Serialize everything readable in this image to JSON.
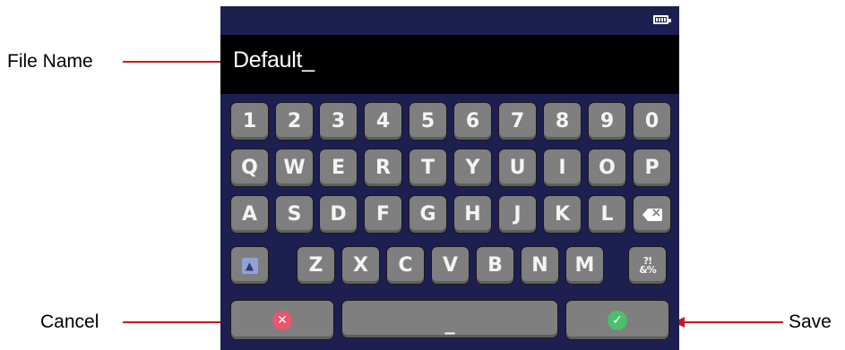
{
  "callouts": {
    "file_name": "File Name",
    "cancel": "Cancel",
    "save": "Save"
  },
  "filename_value": "Default_",
  "keyboard": {
    "row1": [
      "1",
      "2",
      "3",
      "4",
      "5",
      "6",
      "7",
      "8",
      "9",
      "0"
    ],
    "row2": [
      "Q",
      "W",
      "E",
      "R",
      "T",
      "Y",
      "U",
      "I",
      "O",
      "P"
    ],
    "row3": [
      "A",
      "S",
      "D",
      "F",
      "G",
      "H",
      "J",
      "K",
      "L"
    ],
    "row4": [
      "Z",
      "X",
      "C",
      "V",
      "B",
      "N",
      "M"
    ],
    "symbols_key": "?!&%",
    "space_key": "_"
  },
  "icons": {
    "battery": "battery-full-icon",
    "backspace": "backspace-icon",
    "shift": "shift-icon",
    "cancel": "cancel-x-icon",
    "save": "check-icon"
  },
  "colors": {
    "screen_bg": "#1c1f4f",
    "key": "#7f7f7f",
    "callout": "#d0151b",
    "cancel": "#e8576b",
    "save": "#4bbf6b"
  }
}
